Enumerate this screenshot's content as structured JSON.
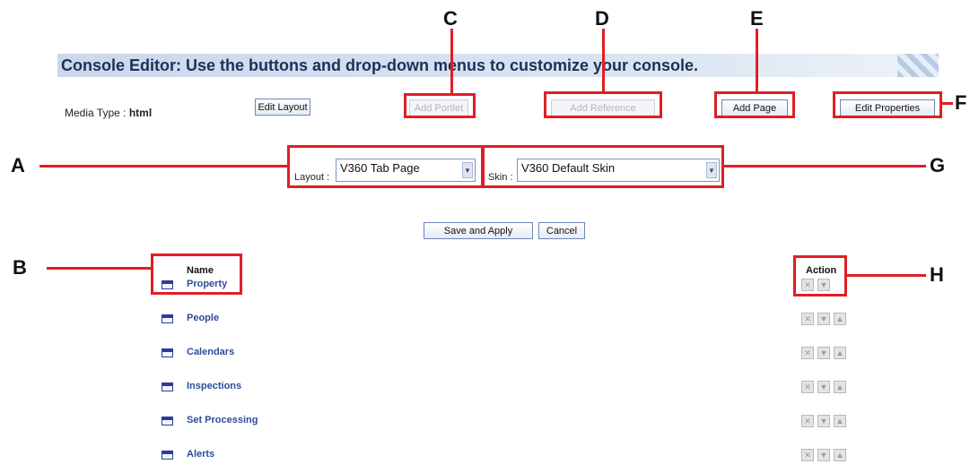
{
  "header": {
    "title": "Console Editor: Use the buttons and drop-down menus to customize your console."
  },
  "media_type": {
    "label": "Media Type : ",
    "value": "html"
  },
  "toolbar": {
    "edit_layout": "Edit Layout",
    "add_portlet": "Add Portlet",
    "add_reference": "Add Reference",
    "add_page": "Add Page",
    "edit_properties": "Edit Properties"
  },
  "layout": {
    "label": "Layout :",
    "value": "V360 Tab Page"
  },
  "skin": {
    "label": "Skin :",
    "value": "V360 Default Skin"
  },
  "actions": {
    "save_apply": "Save and Apply",
    "cancel": "Cancel"
  },
  "list": {
    "name_header": "Name",
    "action_header": "Action",
    "rows": [
      {
        "label": "Property"
      },
      {
        "label": "People"
      },
      {
        "label": "Calendars"
      },
      {
        "label": "Inspections"
      },
      {
        "label": "Set Processing"
      },
      {
        "label": "Alerts"
      }
    ]
  },
  "callouts": {
    "A": "A",
    "B": "B",
    "C": "C",
    "D": "D",
    "E": "E",
    "F": "F",
    "G": "G",
    "H": "H"
  },
  "colors": {
    "callout": "#e01e26",
    "banner": "#c9d8ec",
    "link": "#2d4b9c"
  },
  "icons": {
    "row": "page-icon",
    "delete": "x-icon",
    "down": "down-arrow-icon",
    "up": "up-arrow-icon"
  }
}
